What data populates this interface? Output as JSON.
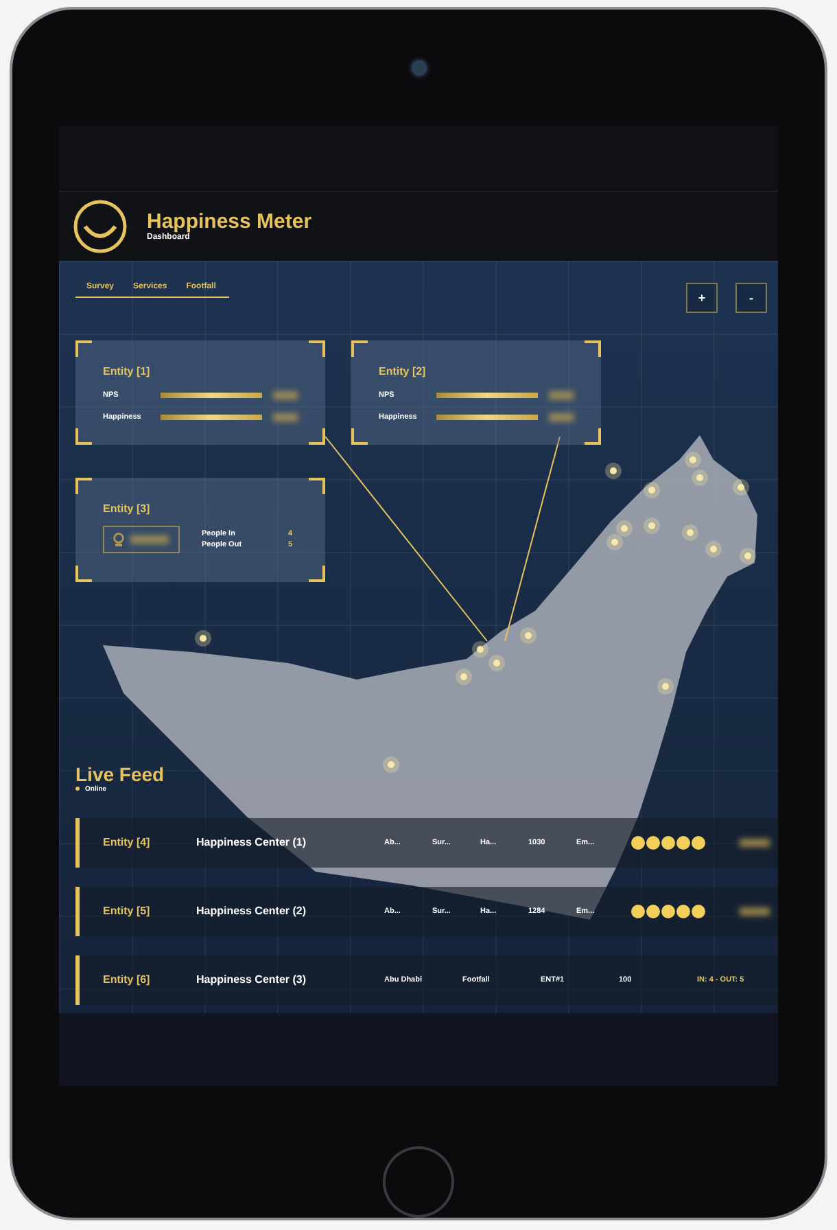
{
  "header": {
    "title": "Happiness Meter",
    "subtitle": "Dashboard"
  },
  "tabs": [
    {
      "label": "Survey"
    },
    {
      "label": "Services"
    },
    {
      "label": "Footfall"
    }
  ],
  "zoom_buttons": [
    "+",
    "-"
  ],
  "entity_cards": [
    {
      "title": "Entity [1]",
      "kind": "meters",
      "metrics": [
        {
          "label": "NPS",
          "level": 1
        },
        {
          "label": "Happiness",
          "level": 1
        }
      ]
    },
    {
      "title": "Entity [2]",
      "kind": "meters",
      "metrics": [
        {
          "label": "NPS",
          "level": 1
        },
        {
          "label": "Happiness",
          "level": 1
        }
      ]
    },
    {
      "title": "Entity [3]",
      "kind": "counts",
      "counts": [
        {
          "label": "People In",
          "value": "4"
        },
        {
          "label": "People Out",
          "value": "5"
        }
      ]
    }
  ],
  "live_feed": {
    "title": "Live Feed",
    "status": "Online",
    "rows": [
      {
        "kind": "rating",
        "entity": "Entity [4]",
        "name": "Happiness Center (1)",
        "cells": [
          "Ab...",
          "Sur...",
          "Ha...",
          "1030",
          "Em..."
        ],
        "stars": 5
      },
      {
        "kind": "rating",
        "entity": "Entity [5]",
        "name": "Happiness Center (2)",
        "cells": [
          "Ab...",
          "Sur...",
          "Ha...",
          "1284",
          "Em..."
        ],
        "stars": 5
      },
      {
        "kind": "footfall",
        "entity": "Entity [6]",
        "name": "Happiness Center (3)",
        "cells": [
          "Abu Dhabi",
          "Footfall",
          "ENT#1",
          "100"
        ],
        "summary": "IN: 4 - OUT: 5"
      }
    ]
  }
}
